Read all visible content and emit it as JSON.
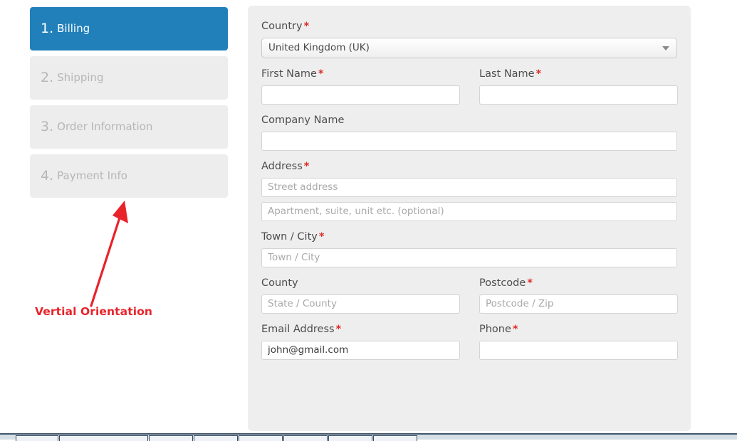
{
  "steps": [
    {
      "num": "1.",
      "label": "Billing",
      "active": true
    },
    {
      "num": "2.",
      "label": "Shipping",
      "active": false
    },
    {
      "num": "3.",
      "label": "Order Information",
      "active": false
    },
    {
      "num": "4.",
      "label": "Payment Info",
      "active": false
    }
  ],
  "annotation": {
    "label": "Vertial Orientation",
    "color": "#e8232a"
  },
  "colors": {
    "active_step": "#2180b9",
    "inactive_step": "#ededed",
    "inactive_text": "#b6b6b6",
    "panel_bg": "#eeeeee",
    "required_asterisk": "#e02b27",
    "label_text": "#4d4d4d"
  },
  "form": {
    "country": {
      "label": "Country",
      "required": "*",
      "value": "United Kingdom (UK)"
    },
    "first_name": {
      "label": "First Name",
      "required": "*",
      "value": "",
      "placeholder": ""
    },
    "last_name": {
      "label": "Last Name",
      "required": "*",
      "value": "",
      "placeholder": ""
    },
    "company_name": {
      "label": "Company Name",
      "required": "",
      "value": "",
      "placeholder": ""
    },
    "address": {
      "label": "Address",
      "required": "*",
      "line1_placeholder": "Street address",
      "line1_value": "",
      "line2_placeholder": "Apartment, suite, unit etc. (optional)",
      "line2_value": ""
    },
    "town_city": {
      "label": "Town / City",
      "required": "*",
      "placeholder": "Town / City",
      "value": ""
    },
    "county": {
      "label": "County",
      "required": "",
      "placeholder": "State / County",
      "value": ""
    },
    "postcode": {
      "label": "Postcode",
      "required": "*",
      "placeholder": "Postcode / Zip",
      "value": ""
    },
    "email": {
      "label": "Email Address",
      "required": "*",
      "placeholder": "",
      "value": "john@gmail.com"
    },
    "phone": {
      "label": "Phone",
      "required": "*",
      "placeholder": "",
      "value": ""
    }
  }
}
